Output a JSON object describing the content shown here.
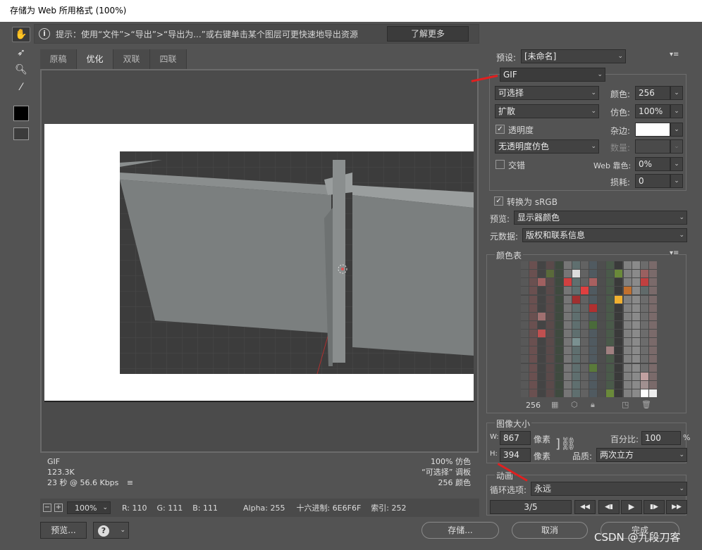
{
  "window": {
    "title": "存储为 Web 所用格式 (100%)"
  },
  "tools": [
    "hand-icon",
    "slice-select-icon",
    "zoom-icon",
    "eyedropper-icon",
    "eyedropper-color",
    "toggle-slices-icon"
  ],
  "hint": {
    "icon": "i",
    "text": "提示：使用“文件”>“导出”>“导出为...”或右键单击某个图层可更快速地导出资源",
    "learn_more": "了解更多"
  },
  "tabs": [
    "原稿",
    "优化",
    "双联",
    "四联"
  ],
  "status": {
    "left": [
      "GIF",
      "123.3K",
      "23 秒 @ 56.6 Kbps"
    ],
    "right": [
      "100% 仿色",
      "“可选择” 调板",
      "256 颜色"
    ],
    "menu_icon": "≡"
  },
  "bottom": {
    "zoom": "100%",
    "r": "R: 110",
    "g": "G: 111",
    "b": "B: 111",
    "alpha": "Alpha: 255",
    "hex": "十六进制: 6E6F6F",
    "index": "索引: 252"
  },
  "buttons": {
    "preview": "预览...",
    "help": "?",
    "save": "存储...",
    "cancel": "取消",
    "done": "完成"
  },
  "settings": {
    "preset_label": "预设:",
    "preset": "[未命名]",
    "format": "GIF",
    "reduction": "可选择",
    "dither_algo": "扩散",
    "colors_label": "颜色:",
    "colors": "256",
    "dither_label": "仿色:",
    "dither": "100%",
    "transparency": "透明度",
    "matte_label": "杂边:",
    "trans_dither": "无透明度仿色",
    "amount_label": "数量:",
    "interlaced": "交错",
    "web_snap_label": "Web 靠色:",
    "web_snap": "0%",
    "lossy_label": "损耗:",
    "lossy": "0",
    "convert_srgb": "转换为 sRGB",
    "preview_label": "预览:",
    "preview": "显示器颜色",
    "metadata_label": "元数据:",
    "metadata": "版权和联系信息"
  },
  "color_table": {
    "title": "颜色表",
    "count": "256"
  },
  "image_size": {
    "title": "图像大小",
    "w_label": "W:",
    "w": "867",
    "h_label": "H:",
    "h": "394",
    "unit": "像素",
    "percent_label": "百分比:",
    "percent": "100",
    "pct_sign": "%",
    "quality_label": "品质:",
    "quality": "两次立方"
  },
  "animation": {
    "title": "动画",
    "loop_label": "循环选项:",
    "loop": "永远",
    "frame": "3/5",
    "controls": [
      "◀◀",
      "◀▮",
      "▶",
      "▮▶",
      "▶▶"
    ]
  },
  "watermark": "CSDN @九段刀客",
  "colors": {
    "accent_arrow": "#e02020",
    "bg": "#535353"
  }
}
